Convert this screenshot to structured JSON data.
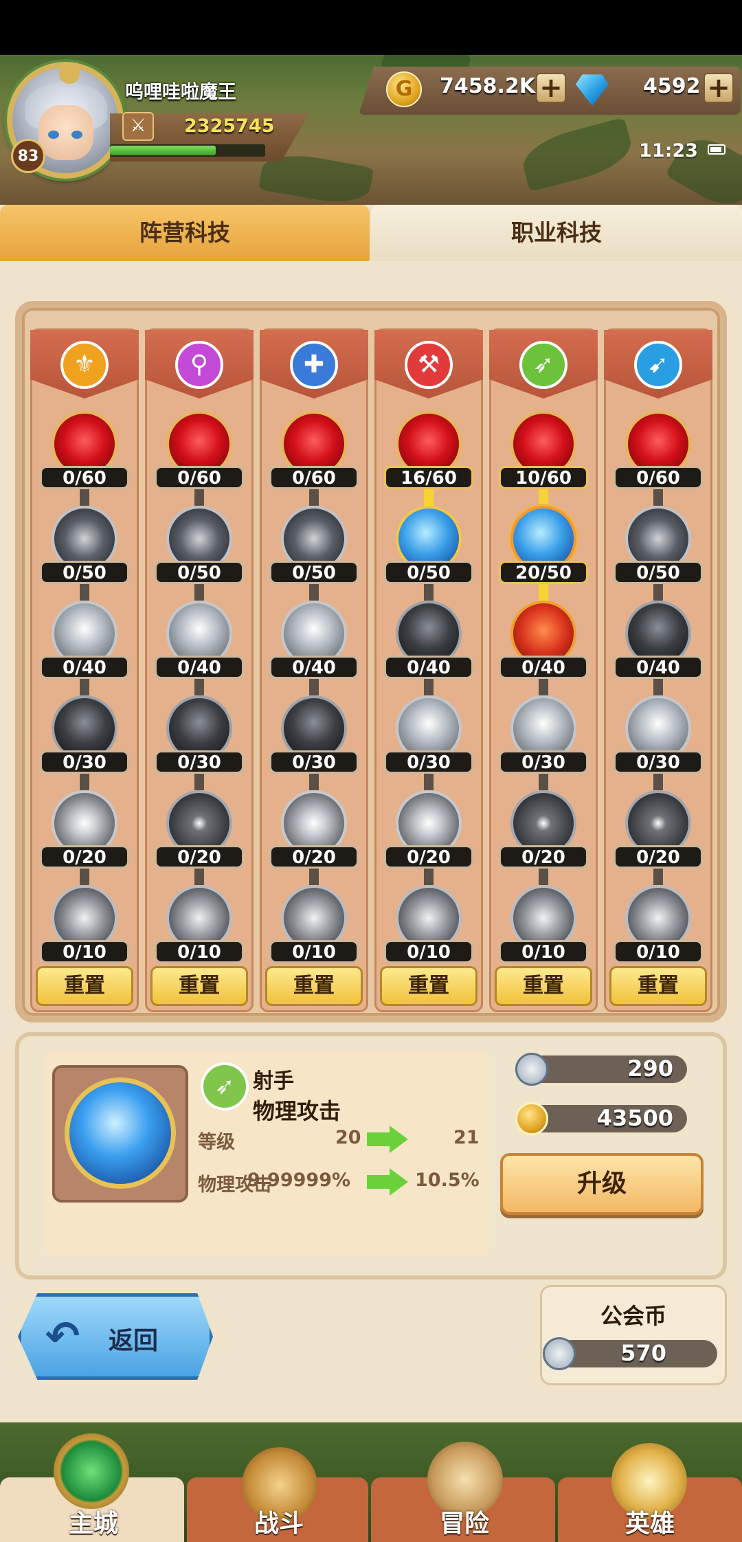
{
  "player": {
    "name": "呜哩哇啦魔王",
    "level": "83",
    "power": "2325745",
    "xp_fraction": 0.68
  },
  "currency": {
    "gold": "7458.2K",
    "gems": "4592",
    "plus_label": "+"
  },
  "status": {
    "time": "11:23"
  },
  "tabs": [
    {
      "label": "阵营科技",
      "active": true
    },
    {
      "label": "职业科技",
      "active": false
    }
  ],
  "tech_columns": [
    {
      "class_icon": "warrior-icon",
      "color": "#f0a11e",
      "symbol": "⚜",
      "counts": [
        "0/60",
        "0/50",
        "0/40",
        "0/30",
        "0/20",
        "0/10"
      ],
      "nodes": [
        "blood",
        "slash-g",
        "sphere-g",
        "shield-g",
        "burst-g",
        "claw-g"
      ],
      "lit": [
        false,
        false,
        false,
        false,
        false,
        false
      ]
    },
    {
      "class_icon": "mage-icon",
      "color": "#c24ad6",
      "symbol": "⚲",
      "counts": [
        "0/60",
        "0/50",
        "0/40",
        "0/30",
        "0/20",
        "0/10"
      ],
      "nodes": [
        "blood",
        "slash-g",
        "sphere-g",
        "shield-g",
        "dark-burst-g",
        "claw-g"
      ],
      "lit": [
        false,
        false,
        false,
        false,
        false,
        false
      ]
    },
    {
      "class_icon": "priest-icon",
      "color": "#3a7ad8",
      "symbol": "✚",
      "counts": [
        "0/60",
        "0/50",
        "0/40",
        "0/30",
        "0/20",
        "0/10"
      ],
      "nodes": [
        "blood",
        "slash-g",
        "sphere-g",
        "shield-g",
        "burst-g",
        "claw-g"
      ],
      "lit": [
        false,
        false,
        false,
        false,
        false,
        false
      ]
    },
    {
      "class_icon": "berserker-icon",
      "color": "#e23a3a",
      "symbol": "⚒",
      "counts": [
        "16/60",
        "0/50",
        "0/40",
        "0/30",
        "0/20",
        "0/10"
      ],
      "nodes": [
        "blood",
        "ice",
        "shield-g",
        "sphere-g",
        "burst-g",
        "claw-g"
      ],
      "lit": [
        true,
        false,
        false,
        false,
        false,
        false
      ]
    },
    {
      "class_icon": "archer-icon",
      "color": "#6cc23a",
      "symbol": "➶",
      "counts": [
        "10/60",
        "20/50",
        "0/40",
        "0/30",
        "0/20",
        "0/10"
      ],
      "nodes": [
        "blood",
        "ice-sel",
        "fire-shield",
        "sphere-g",
        "dark-burst-g",
        "claw-g"
      ],
      "lit": [
        true,
        true,
        false,
        false,
        false,
        false
      ]
    },
    {
      "class_icon": "assassin-icon",
      "color": "#2a9ee3",
      "symbol": "➹",
      "counts": [
        "0/60",
        "0/50",
        "0/40",
        "0/30",
        "0/20",
        "0/10"
      ],
      "nodes": [
        "blood",
        "slash-g",
        "shield-g",
        "sphere-g",
        "dark-burst-g",
        "claw-g"
      ],
      "lit": [
        false,
        false,
        false,
        false,
        false,
        false
      ]
    }
  ],
  "reset_label": "重置",
  "detail": {
    "class_name": "射手",
    "skill_name": "物理攻击",
    "level_label": "等级",
    "level_from": "20",
    "level_to": "21",
    "stat_label": "物理攻击",
    "stat_from": "9.99999%",
    "stat_to": "10.5%",
    "cost_guild": "290",
    "cost_gold": "43500",
    "upgrade_label": "升级"
  },
  "back_label": "返回",
  "guild_coin": {
    "title": "公会币",
    "value": "570"
  },
  "bottom_nav": [
    {
      "label": "主城",
      "active": true
    },
    {
      "label": "战斗",
      "active": false
    },
    {
      "label": "冒险",
      "active": false
    },
    {
      "label": "英雄",
      "active": false
    }
  ],
  "colors": {
    "accent_tab": "#e6a33b",
    "panel": "#efe3cb",
    "count_lit_border": "#e9c25a"
  }
}
